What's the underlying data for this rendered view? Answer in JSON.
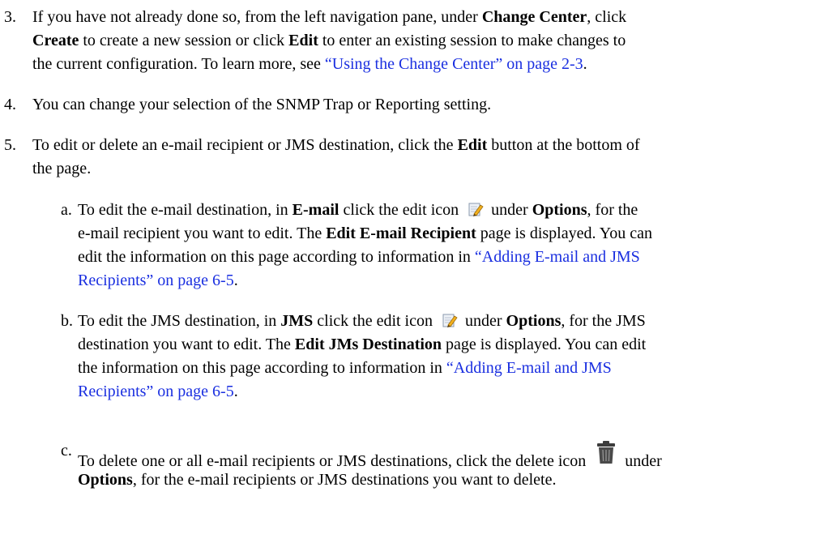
{
  "steps": [
    {
      "number": "3.",
      "t1": "If you have not already done so, from the left navigation pane, under ",
      "b1": "Change Center",
      "t2": ", click",
      "b2": "Create",
      "t3": " to create a new session or click ",
      "b3": "Edit",
      "t4": " to enter an existing session to make changes to",
      "t5": "the current configuration. To learn more, see ",
      "link": "“Using the Change Center” on page 2-3",
      "t6": "."
    },
    {
      "number": "4.",
      "text": "You can change your selection of the SNMP Trap or Reporting setting."
    },
    {
      "number": "5.",
      "t1": "To edit or delete an e-mail recipient or JMS destination, click the ",
      "b1": "Edit",
      "t2": " button at the bottom of",
      "t3": "the page."
    }
  ],
  "substeps": [
    {
      "letter": "a.",
      "t1": "To edit the e-mail destination, in ",
      "b1": "E-mail",
      "t2": " click the edit icon ",
      "icon": "edit-icon",
      "t3": " under ",
      "b2": "Options",
      "t4": ", for the",
      "t5": "e-mail recipient you want to edit. The ",
      "b3": "Edit E-mail Recipient",
      "t6": " page is displayed. You can",
      "t7": "edit the information on this page according to information in ",
      "link1": "“Adding E-mail and JMS",
      "link2": "Recipients” on page 6-5",
      "t8": "."
    },
    {
      "letter": "b.",
      "t1": "To edit the JMS destination, in ",
      "b1": "JMS",
      "t2": " click the edit icon ",
      "icon": "edit-icon",
      "t3": " under ",
      "b2": "Options",
      "t4": ", for the JMS",
      "t5": "destination you want to edit. The ",
      "b3": "Edit JMs Destination",
      "t6": " page is displayed. You can edit",
      "t7": "the information on this page according to information in ",
      "link1": "“Adding E-mail and JMS",
      "link2": "Recipients” on page 6-5",
      "t8": "."
    },
    {
      "letter": "c.",
      "t1": "To delete one or all e-mail recipients or JMS destinations, click the delete icon ",
      "icon": "trash-icon",
      "t2": " under",
      "b1": "Options",
      "t3": ", for the e-mail recipients or JMS destinations you want to delete."
    }
  ]
}
